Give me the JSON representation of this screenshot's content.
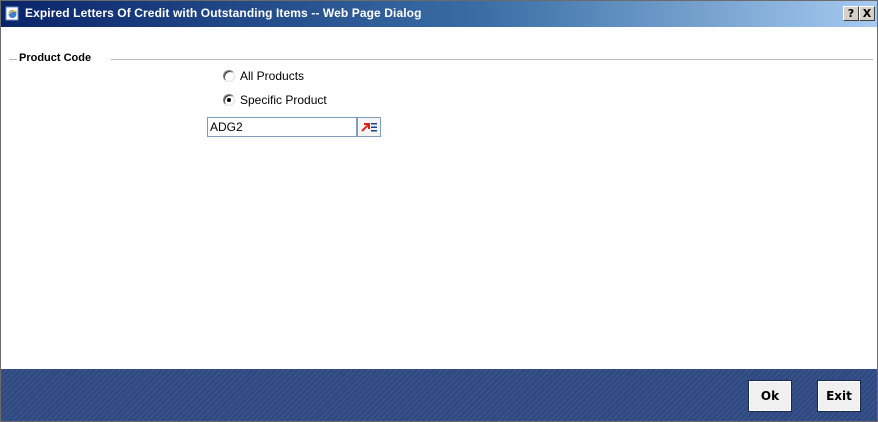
{
  "window": {
    "title": "Expired Letters Of Credit with Outstanding Items -- Web Page Dialog",
    "help_label": "?",
    "close_label": "X"
  },
  "product_code": {
    "legend": "Product Code",
    "options": [
      {
        "label": "All Products",
        "selected": false
      },
      {
        "label": "Specific Product",
        "selected": true
      }
    ],
    "product_value": "ADG2",
    "lov_icon": "list-of-values-icon"
  },
  "footer": {
    "ok_label": "Ok",
    "exit_label": "Exit"
  },
  "colors": {
    "footer_bg": "#2f4a82",
    "title_start": "#0a246a",
    "title_end": "#a6caf0"
  }
}
